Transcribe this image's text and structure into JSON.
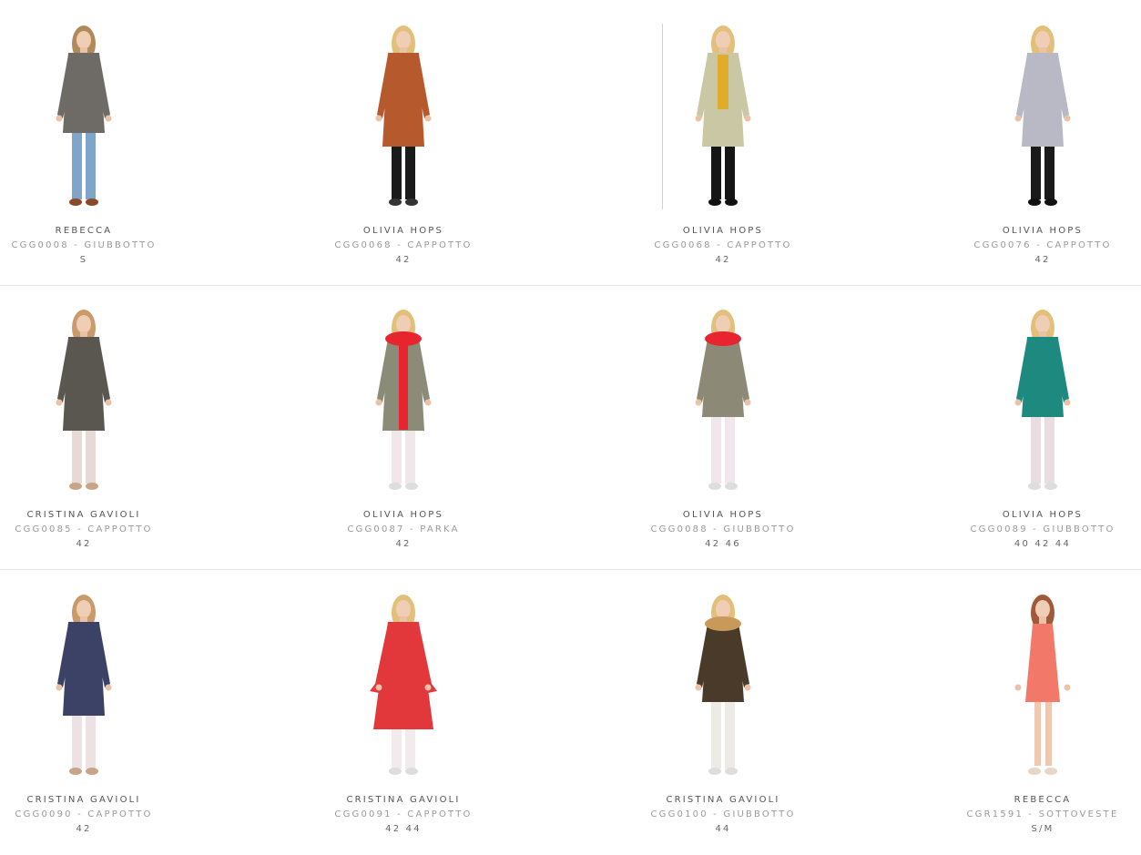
{
  "products": [
    {
      "brand": "REBECCA",
      "code": "CGG0008 - GIUBBOTTO",
      "sizes": "S",
      "colors": {
        "top": "#6e6a66",
        "bottom": "#7fa6c9",
        "hair": "#b08a5a",
        "shoes": "#8a4a2a"
      },
      "style": "jacket"
    },
    {
      "brand": "OLIVIA HOPS",
      "code": "CGG0068 - CAPPOTTO",
      "sizes": "42",
      "colors": {
        "top": "#b65a2e",
        "bottom": "#1a1a1a",
        "hair": "#e2c07a",
        "shoes": "#333333"
      },
      "style": "coat"
    },
    {
      "brand": "OLIVIA HOPS",
      "code": "CGG0068 - CAPPOTTO",
      "sizes": "42",
      "colors": {
        "top": "#c9c7a4",
        "bottom": "#151515",
        "hair": "#e2c07a",
        "shoes": "#111111",
        "inner": "#e0ac2a"
      },
      "style": "coat-open"
    },
    {
      "brand": "OLIVIA HOPS",
      "code": "CGG0076 - CAPPOTTO",
      "sizes": "42",
      "colors": {
        "top": "#b9b9c6",
        "bottom": "#1a1a1a",
        "hair": "#e2c07a",
        "shoes": "#111111"
      },
      "style": "coat"
    },
    {
      "brand": "CRISTINA GAVIOLI",
      "code": "CGG0085 - CAPPOTTO",
      "sizes": "42",
      "colors": {
        "top": "#5a5650",
        "bottom": "#e6d9d6",
        "hair": "#c99a6a",
        "shoes": "#c8a588"
      },
      "style": "coat"
    },
    {
      "brand": "OLIVIA HOPS",
      "code": "CGG0087 - PARKA",
      "sizes": "42",
      "colors": {
        "top": "#8b8c78",
        "bottom": "#f1e6e9",
        "hair": "#e2c07a",
        "shoes": "#dddddd",
        "inner": "#e8242e"
      },
      "style": "parka"
    },
    {
      "brand": "OLIVIA HOPS",
      "code": "CGG0088 - GIUBBOTTO",
      "sizes": "42 46",
      "colors": {
        "top": "#8c8a76",
        "bottom": "#f1e6ec",
        "hair": "#e2c07a",
        "shoes": "#dddddd",
        "inner": "#e8242e"
      },
      "style": "jacket-fur"
    },
    {
      "brand": "OLIVIA HOPS",
      "code": "CGG0089 - GIUBBOTTO",
      "sizes": "40 42 44",
      "colors": {
        "top": "#1e8a7f",
        "bottom": "#e9dde2",
        "hair": "#e2c07a",
        "shoes": "#dddddd"
      },
      "style": "jacket"
    },
    {
      "brand": "CRISTINA GAVIOLI",
      "code": "CGG0090 - CAPPOTTO",
      "sizes": "42",
      "colors": {
        "top": "#3c4166",
        "bottom": "#ece2e4",
        "hair": "#c99a6a",
        "shoes": "#c8a588"
      },
      "style": "coat"
    },
    {
      "brand": "CRISTINA GAVIOLI",
      "code": "CGG0091 - CAPPOTTO",
      "sizes": "42 44",
      "colors": {
        "top": "#e2383b",
        "bottom": "#f2eaec",
        "hair": "#e2c07a",
        "shoes": "#dddddd"
      },
      "style": "coat-flare"
    },
    {
      "brand": "CRISTINA GAVIOLI",
      "code": "CGG0100 - GIUBBOTTO",
      "sizes": "44",
      "colors": {
        "top": "#4a3a2a",
        "bottom": "#eeeae6",
        "hair": "#e2c07a",
        "shoes": "#dddddd",
        "inner": "#c89a5a"
      },
      "style": "jacket-fur"
    },
    {
      "brand": "REBECCA",
      "code": "CGR1591 - SOTTOVESTE",
      "sizes": "S/M",
      "colors": {
        "top": "#f2786a",
        "bottom": "#f0c8b2",
        "hair": "#a05a3a",
        "shoes": "#e8d6c8"
      },
      "style": "dress"
    }
  ]
}
